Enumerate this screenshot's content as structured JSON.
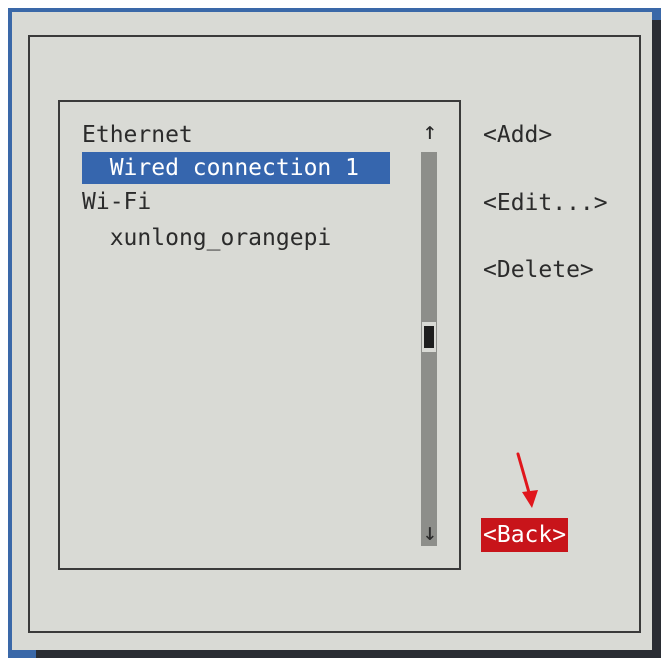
{
  "list": {
    "items": [
      {
        "label": "Ethernet",
        "indent": 0,
        "selected": false
      },
      {
        "label": "Wired connection 1",
        "indent": 2,
        "selected": true
      },
      {
        "label": "Wi-Fi",
        "indent": 0,
        "selected": false
      },
      {
        "label": "xunlong_orangepi",
        "indent": 2,
        "selected": false
      }
    ],
    "scroll_up_glyph": "↑",
    "scroll_down_glyph": "↓"
  },
  "buttons": {
    "add": "<Add>",
    "edit": "<Edit...>",
    "delete": "<Delete>",
    "back": "<Back>"
  },
  "colors": {
    "terminal_bg": "#3a68a8",
    "dialog_bg": "#d9dad5",
    "selection": "#3666ae",
    "active_button": "#c8141a",
    "annotation_arrow": "#e0161c"
  },
  "icons": {
    "annotation": "red-arrow-down-icon"
  }
}
